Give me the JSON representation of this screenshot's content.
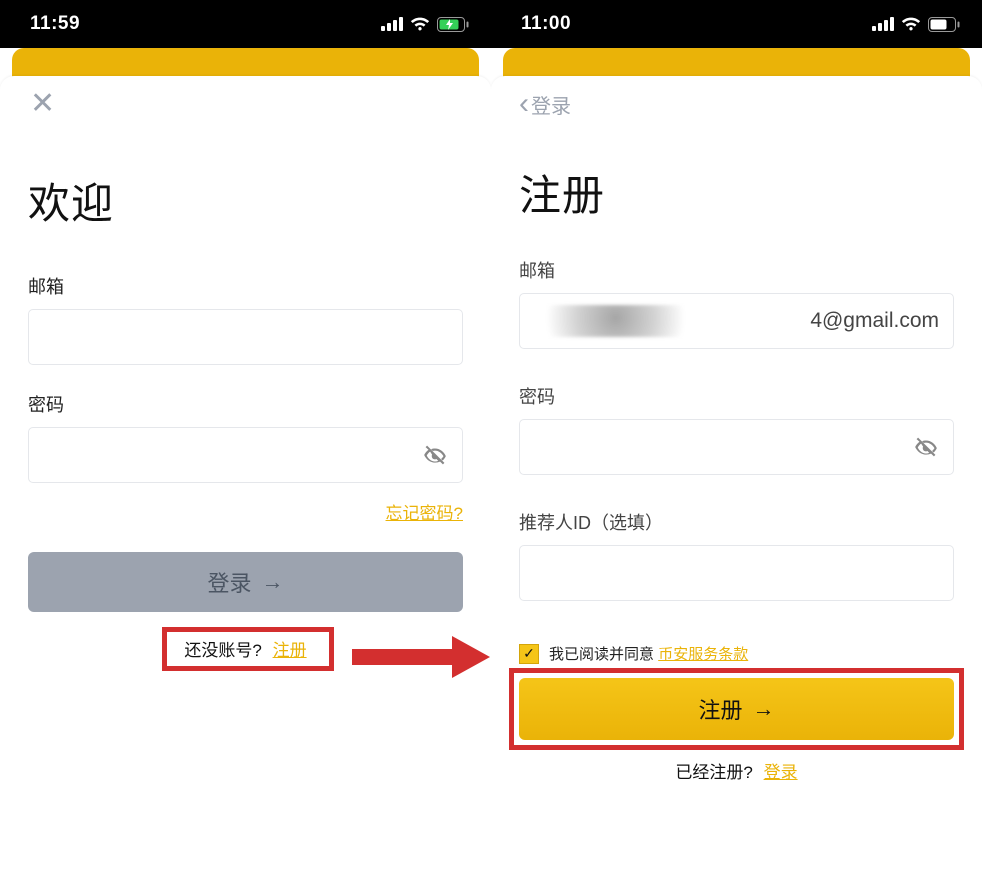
{
  "left": {
    "status": {
      "time": "11:59",
      "battery_charging": true
    },
    "title": "欢迎",
    "email_label": "邮箱",
    "password_label": "密码",
    "forgot": "忘记密码?",
    "login_btn": "登录",
    "no_account": "还没账号?",
    "register_link": "注册"
  },
  "right": {
    "status": {
      "time": "11:00",
      "battery_charging": false
    },
    "back_label": "登录",
    "title": "注册",
    "email_label": "邮箱",
    "email_value_tail": "4@gmail.com",
    "password_label": "密码",
    "referrer_label": "推荐人ID（选填）",
    "terms_prefix": "我已阅读并同意",
    "terms_link": "币安服务条款",
    "register_btn": "注册",
    "already": "已经注册?",
    "login_link": "登录"
  },
  "icons": {
    "close": "✕",
    "chevron_left": "‹",
    "arrow_right": "→",
    "eye_off": "eye-off",
    "check": "✓"
  }
}
